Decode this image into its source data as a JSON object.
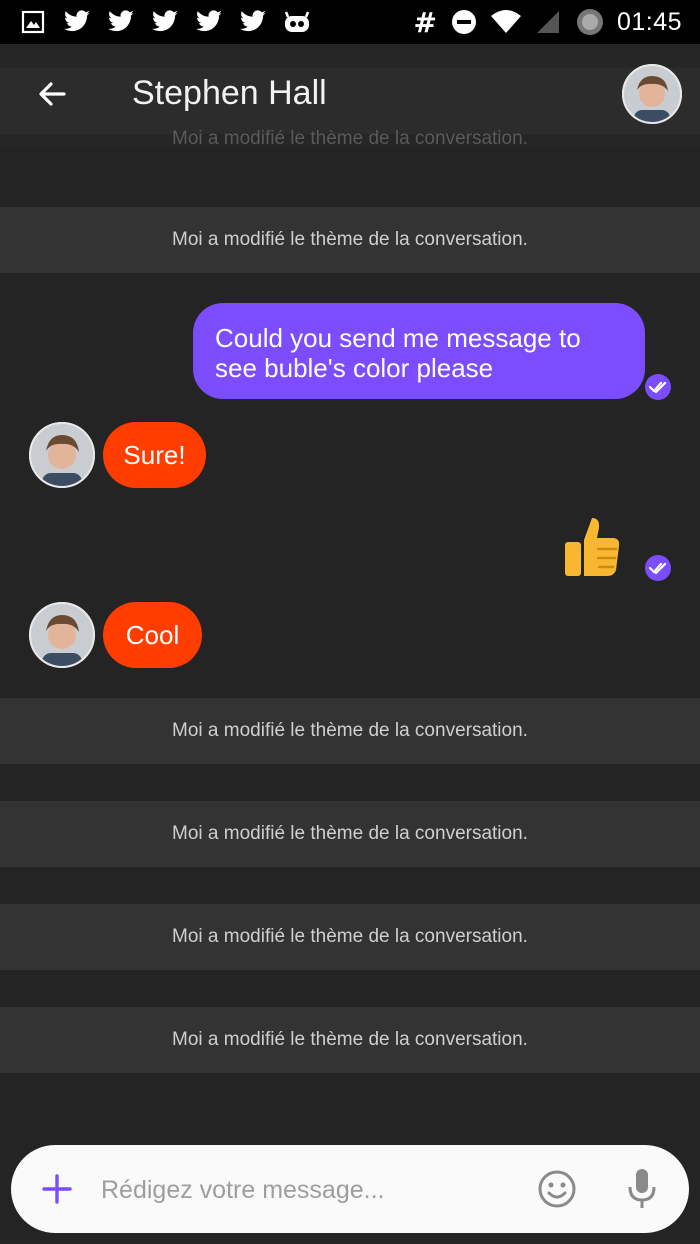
{
  "status_bar": {
    "time": "01:45",
    "hash": "#",
    "left_icons": [
      "gallery-icon",
      "twitter-icon",
      "twitter-icon",
      "twitter-icon",
      "twitter-icon",
      "twitter-icon",
      "cyanogen-icon"
    ],
    "right_icons": [
      "hash-icon",
      "dnd-icon",
      "wifi-icon",
      "signal-icon",
      "battery-icon"
    ]
  },
  "header": {
    "title": "Stephen Hall",
    "back_icon": "arrow-back-icon",
    "avatar": "contact-avatar",
    "ghost_text": "Moi a modifié le thème de la conversation."
  },
  "messages": {
    "theme_change": "Moi a modifié le thème de la conversation.",
    "outgoing_1": "Could you send me message to see buble's color please",
    "incoming_1": "Sure!",
    "outgoing_2_emoji": "thumbs-up-icon",
    "incoming_2": "Cool"
  },
  "composer": {
    "placeholder": "Rédigez votre message...",
    "icons": [
      "plus-icon",
      "emoji-icon",
      "microphone-icon"
    ]
  },
  "colors": {
    "background": "#242424",
    "outgoing_bubble": "#7c4dff",
    "incoming_bubble": "#ff3d00",
    "system_band": "#333333",
    "composer": "#fafafa",
    "status_bar": "#000000"
  }
}
